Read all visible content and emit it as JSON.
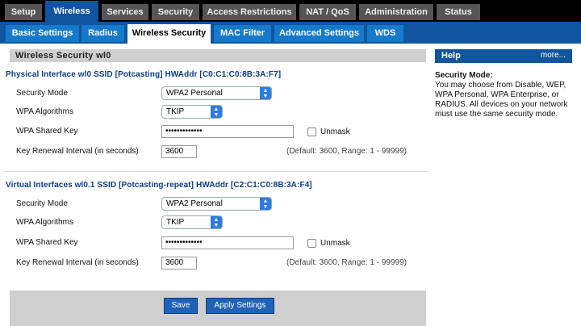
{
  "nav": {
    "tabs": [
      "Setup",
      "Wireless",
      "Services",
      "Security",
      "Access Restrictions",
      "NAT / QoS",
      "Administration",
      "Status"
    ],
    "active": "Wireless"
  },
  "subnav": {
    "tabs": [
      "Basic Settings",
      "Radius",
      "Wireless Security",
      "MAC Filter",
      "Advanced Settings",
      "WDS"
    ],
    "active": "Wireless Security"
  },
  "section": {
    "title": "Wireless Security wl0"
  },
  "interfaces": [
    {
      "title": "Physical Interface wl0 SSID [Potcasting] HWAddr [C0:C1:C0:8B:3A:F7]",
      "security_mode_label": "Security Mode",
      "security_mode_value": "WPA2 Personal",
      "wpa_alg_label": "WPA Algorithms",
      "wpa_alg_value": "TKIP",
      "shared_key_label": "WPA Shared Key",
      "shared_key_value": "•••••••••••••",
      "unmask_label": "Unmask",
      "renewal_label": "Key Renewal Interval (in seconds)",
      "renewal_value": "3600",
      "renewal_hint": "(Default: 3600, Range: 1 - 99999)"
    },
    {
      "title": "Virtual Interfaces wl0.1 SSID [Potcasting-repeat] HWAddr [C2:C1:C0:8B:3A:F4]",
      "security_mode_label": "Security Mode",
      "security_mode_value": "WPA2 Personal",
      "wpa_alg_label": "WPA Algorithms",
      "wpa_alg_value": "TKIP",
      "shared_key_label": "WPA Shared Key",
      "shared_key_value": "•••••••••••••",
      "unmask_label": "Unmask",
      "renewal_label": "Key Renewal Interval (in seconds)",
      "renewal_value": "3600",
      "renewal_hint": "(Default: 3600, Range: 1 - 99999)"
    }
  ],
  "buttons": {
    "save": "Save",
    "apply": "Apply Settings"
  },
  "help": {
    "title": "Help",
    "more": "more...",
    "subtitle": "Security Mode:",
    "text": "You may choose from Disable, WEP, WPA Personal, WPA Enterprise, or RADIUS. All devices on your network must use the same security mode."
  },
  "colors": {
    "nav_bg": "#000000",
    "accent": "#10559e",
    "tab_inactive": "#555555",
    "subtab": "#1679c9"
  }
}
